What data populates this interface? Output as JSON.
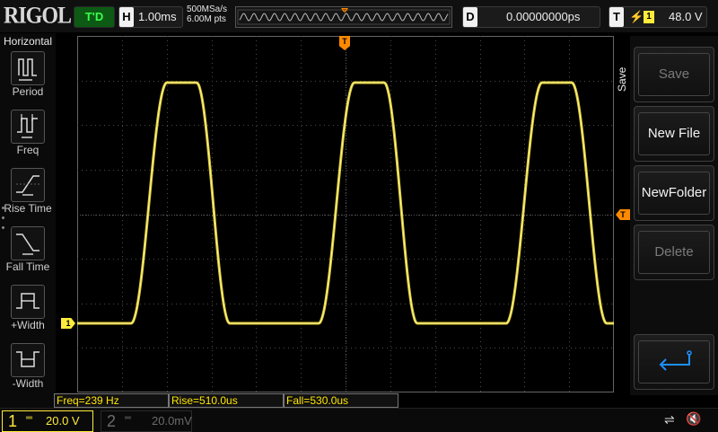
{
  "brand": "RIGOL",
  "top": {
    "trigger_status": "T'D",
    "timebase_key": "H",
    "timebase": "1.00ms",
    "sample_rate": "500MSa/s",
    "memory_depth": "6.00M pts",
    "delay_key": "D",
    "delay": "0.00000000ps",
    "trigger_key": "T",
    "trigger_edge_icon": "rising-edge-icon",
    "trigger_source": "1",
    "trigger_level": "48.0 V"
  },
  "left_menu": {
    "title": "Horizontal",
    "items": [
      {
        "label": "Period",
        "icon": "period-icon"
      },
      {
        "label": "Freq",
        "icon": "freq-icon"
      },
      {
        "label": "Rise Time",
        "icon": "rise-time-icon"
      },
      {
        "label": "Fall Time",
        "icon": "fall-time-icon"
      },
      {
        "label": "+Width",
        "icon": "pos-width-icon"
      },
      {
        "label": "-Width",
        "icon": "neg-width-icon"
      }
    ]
  },
  "right_menu": {
    "title": "Save",
    "buttons": [
      {
        "label": "Save",
        "enabled": false
      },
      {
        "label": "New File",
        "enabled": true
      },
      {
        "label": "NewFolder",
        "enabled": true
      },
      {
        "label": "Delete",
        "enabled": false
      },
      {
        "label": "",
        "icon": "return-icon",
        "enabled": true
      }
    ]
  },
  "markers": {
    "ch1": "1",
    "trigger": "T",
    "trigger_position": "T"
  },
  "measurements": [
    {
      "text": "Freq=239 Hz"
    },
    {
      "text": "Rise=510.0us"
    },
    {
      "text": "Fall=530.0us"
    }
  ],
  "channels": [
    {
      "num": "1",
      "coupling": "═",
      "scale": "20.0 V",
      "color": "#ffeb3b",
      "active": true
    },
    {
      "num": "2",
      "coupling": "═",
      "scale": "20.0mV",
      "color": "#6b6b6b",
      "active": false
    }
  ],
  "status_icons": [
    "usb-icon",
    "mute-icon"
  ],
  "colors": {
    "ch1": "#ffeb3b",
    "trigger": "#ff8a00",
    "grid": "#4a4a4a"
  }
}
